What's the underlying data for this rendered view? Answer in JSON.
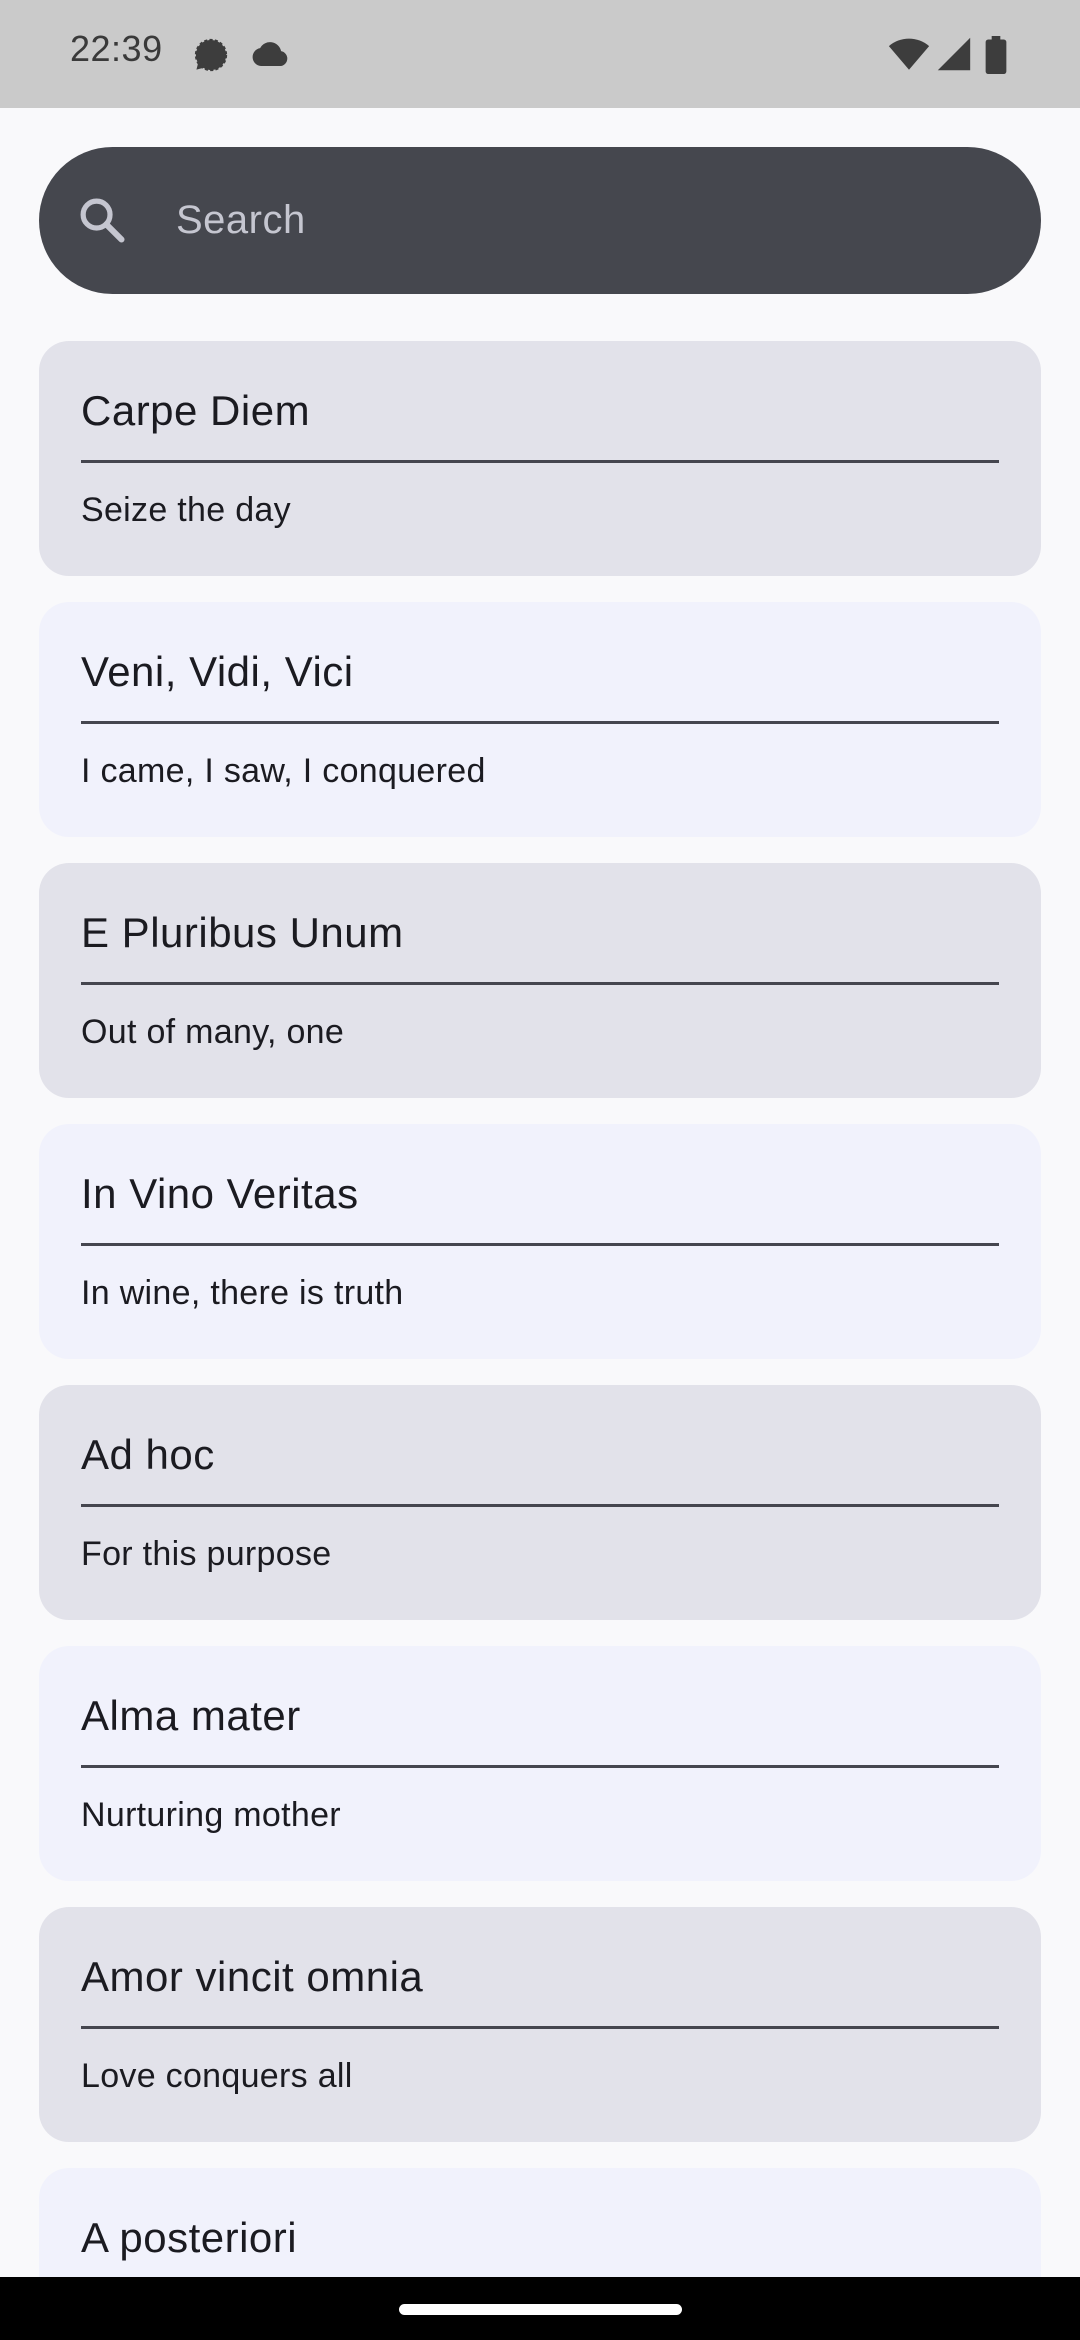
{
  "status_bar": {
    "time": "22:39",
    "notification_icons": [
      "signal-messenger-icon",
      "cloud-icon"
    ],
    "system_icons": [
      "wifi-icon",
      "cellular-signal-icon",
      "battery-icon"
    ]
  },
  "search": {
    "placeholder": "Search",
    "value": "",
    "icon": "search-icon",
    "colors": {
      "bar": "#45474e",
      "placeholder": "#c5c6d0"
    }
  },
  "phrases": [
    {
      "title": "Carpe Diem",
      "subtitle": "Seize the day"
    },
    {
      "title": "Veni, Vidi, Vici",
      "subtitle": "I came, I saw, I conquered"
    },
    {
      "title": "E Pluribus Unum",
      "subtitle": "Out of many, one"
    },
    {
      "title": "In Vino Veritas",
      "subtitle": "In wine, there is truth"
    },
    {
      "title": "Ad hoc",
      "subtitle": "For this purpose"
    },
    {
      "title": "Alma mater",
      "subtitle": "Nurturing mother"
    },
    {
      "title": "Amor vincit omnia",
      "subtitle": "Love conquers all"
    },
    {
      "title": "A posteriori",
      "subtitle": ""
    }
  ],
  "colors": {
    "background": "#f9f9fb",
    "card_odd": "#e2e2ea",
    "card_even": "#f1f2fc",
    "divider": "#45464f",
    "text": "#1b1b21"
  }
}
